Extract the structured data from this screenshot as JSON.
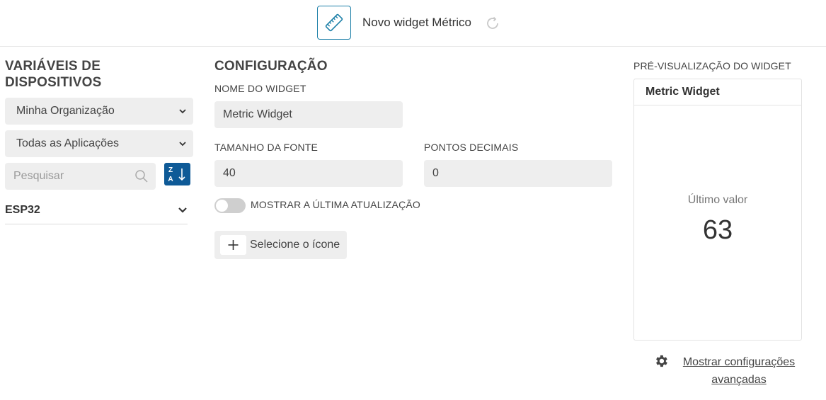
{
  "header": {
    "title": "Novo widget Métrico",
    "widget_icon": "ruler-icon",
    "status_icon": "refresh-icon"
  },
  "devices_panel": {
    "title": "VARIÁVEIS DE DISPOSITIVOS",
    "organization_select": "Minha Organização",
    "application_select": "Todas as Aplicações",
    "search_placeholder": "Pesquisar",
    "sort_button_top": "Z",
    "sort_button_bottom": "A",
    "device_name": "ESP32"
  },
  "config": {
    "title": "CONFIGURAÇÃO",
    "widget_name_label": "NOME DO WIDGET",
    "widget_name_value": "Metric Widget",
    "font_size_label": "TAMANHO DA FONTE",
    "font_size_value": "40",
    "decimal_points_label": "PONTOS DECIMAIS",
    "decimal_points_value": "0",
    "show_last_update_label": "MOSTRAR A ÚLTIMA ATUALIZAÇÃO",
    "show_last_update_on": false,
    "select_icon_label": "Selecione o ícone"
  },
  "preview": {
    "label": "PRÉ-VISUALIZAÇÃO DO WIDGET",
    "card_title": "Metric Widget",
    "last_value_label": "Último valor",
    "last_value": "63",
    "advanced_link_line1": "Mostrar configurações",
    "advanced_link_line2": "avançadas"
  },
  "colors": {
    "accent": "#0e5a97",
    "icon_border": "#1c7fa8",
    "field_bg": "#eeeeee"
  }
}
